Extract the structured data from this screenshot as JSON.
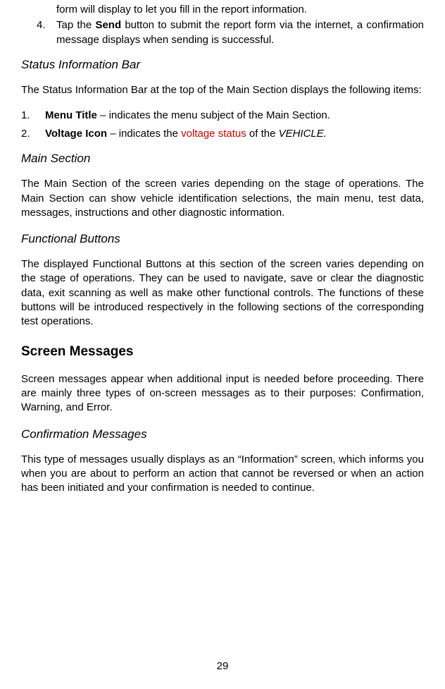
{
  "topLine": "form will display to let you fill in the report information.",
  "list4": {
    "num": "4.",
    "prefix": "Tap the ",
    "bold": "Send",
    "suffix": " button to submit the report form via the internet, a confirmation message displays when sending is successful."
  },
  "statusBar": {
    "heading": "Status Information Bar",
    "intro": "The Status Information Bar at the top of the Main Section displays the following items:",
    "item1": {
      "num": "1.",
      "bold": "Menu Title",
      "rest": " – indicates the menu subject of the Main Section."
    },
    "item2": {
      "num": "2.",
      "bold": "Voltage Icon",
      "rest1": " – indicates the ",
      "red": "voltage status",
      "rest2": " of the ",
      "italic": "VEHICLE.",
      "rest3": ""
    }
  },
  "mainSection": {
    "heading": "Main Section",
    "para": "The Main Section of the screen varies depending on the stage of operations. The Main Section can show vehicle identification selections, the main menu, test data, messages, instructions and other diagnostic information."
  },
  "funcButtons": {
    "heading": "Functional Buttons",
    "para": "The displayed Functional Buttons at this section of the screen varies depending on the stage of operations. They can be used to navigate, save or clear the diagnostic data, exit scanning as well as make other functional controls. The functions of these buttons will be introduced respectively in the following sections of the corresponding test operations."
  },
  "screenMessages": {
    "heading": "Screen Messages",
    "para": "Screen messages appear when additional input is needed before proceeding. There are mainly three types of on-screen messages as to their purposes: Confirmation, Warning, and Error."
  },
  "confirmation": {
    "heading": "Confirmation Messages",
    "para": "This type of messages usually displays as an “Information” screen, which informs you when you are about to perform an action that cannot be reversed or when an action has been initiated and your confirmation is needed to continue."
  },
  "pageNum": "29"
}
